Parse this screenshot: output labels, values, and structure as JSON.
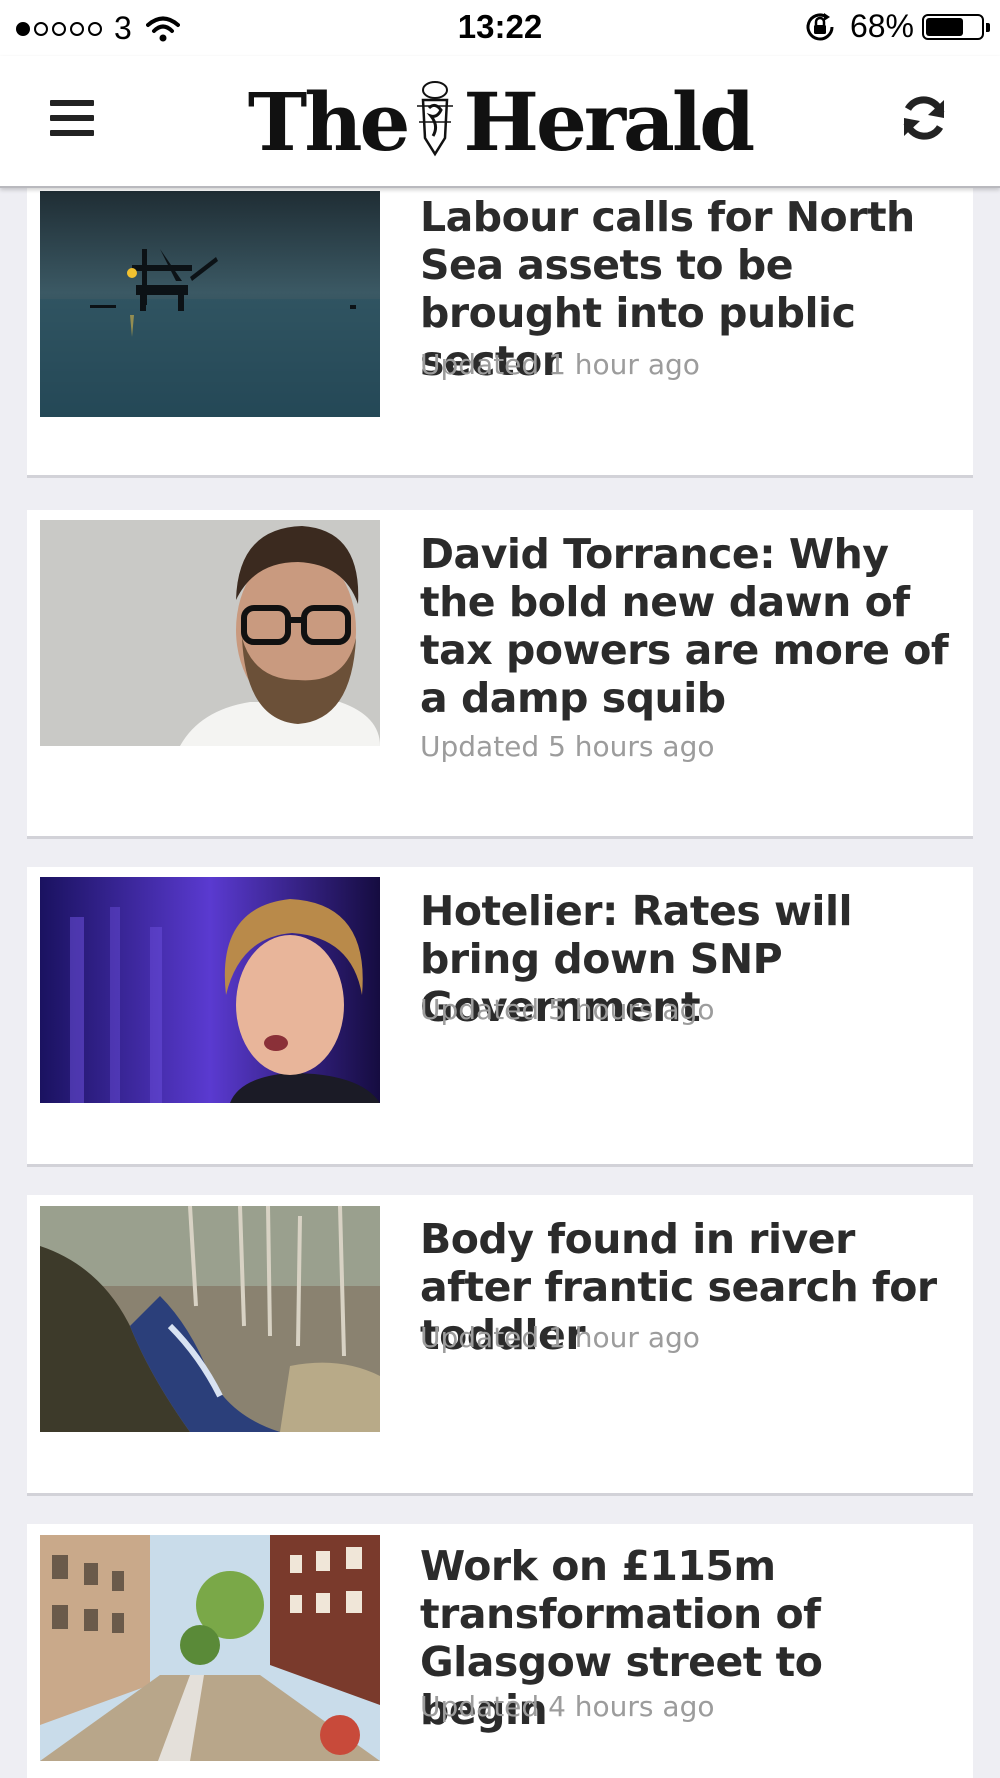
{
  "status_bar": {
    "carrier": "3",
    "time": "13:22",
    "battery_text": "68%",
    "battery_level": 0.68,
    "signal_strength": 1
  },
  "header": {
    "logo_text_left": "The",
    "logo_text_right": "Herald",
    "menu_icon": "hamburger-icon",
    "refresh_icon": "refresh-icon"
  },
  "articles": [
    {
      "headline": "Labour calls for North Sea assets to be brought into public sector",
      "updated": "Updated 1 hour ago",
      "image": "oil-rig-at-sea"
    },
    {
      "headline": "David Torrance: Why the bold new dawn of tax powers are more of a damp squib",
      "updated": "Updated 5 hours ago",
      "image": "bearded-man-with-glasses"
    },
    {
      "headline": "Hotelier: Rates will bring down SNP Government",
      "updated": "Updated 5 hours ago",
      "image": "woman-speaking-purple-background"
    },
    {
      "headline": "Body found in river after frantic search for toddler",
      "updated": "Updated 1 hour ago",
      "image": "river-in-woodland"
    },
    {
      "headline": "Work on £115m transformation of Glasgow street to begin",
      "updated": "Updated 4 hours ago",
      "image": "glasgow-street-artist-impression"
    }
  ]
}
